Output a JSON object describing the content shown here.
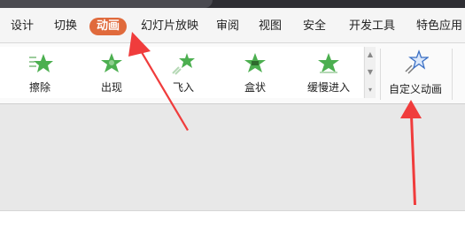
{
  "menu": {
    "tabs": [
      {
        "label": "设计"
      },
      {
        "label": "切换"
      },
      {
        "label": "动画"
      },
      {
        "label": "幻灯片放映"
      },
      {
        "label": "审阅"
      },
      {
        "label": "视图"
      },
      {
        "label": "安全"
      },
      {
        "label": "开发工具"
      },
      {
        "label": "特色应用"
      }
    ],
    "active_color": "#e06a3c"
  },
  "ribbon": {
    "effects": [
      {
        "label": "擦除",
        "icon": "wipe-star-icon"
      },
      {
        "label": "出现",
        "icon": "appear-star-icon"
      },
      {
        "label": "飞入",
        "icon": "fly-in-star-icon"
      },
      {
        "label": "盒状",
        "icon": "box-star-icon"
      },
      {
        "label": "缓慢进入",
        "icon": "slow-enter-star-icon"
      }
    ],
    "custom_animation": {
      "label": "自定义动画",
      "icon": "custom-animation-star-icon"
    },
    "star_color": "#4caf50",
    "arrow_color": "#f03c3c"
  }
}
